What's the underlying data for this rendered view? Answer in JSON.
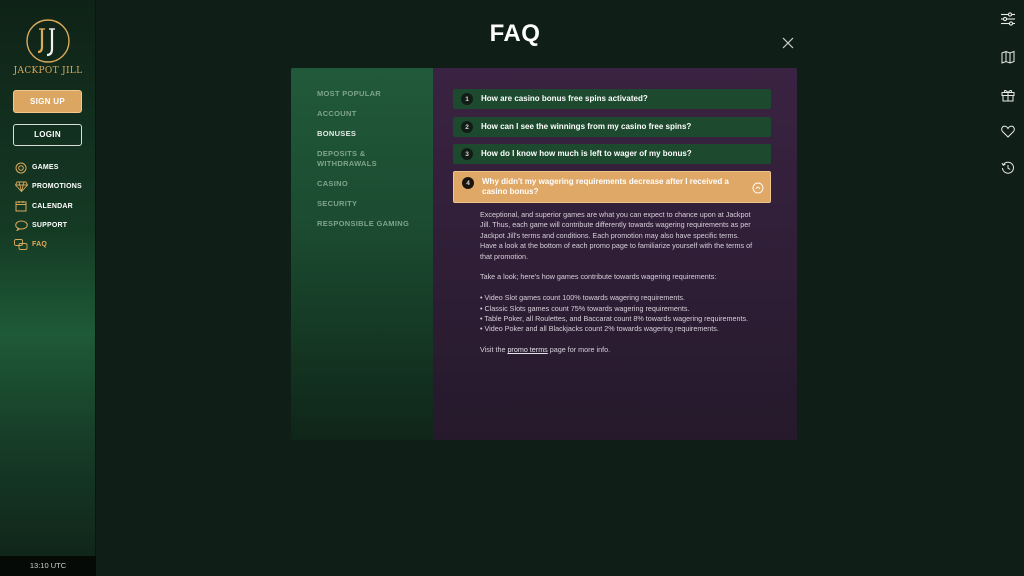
{
  "brand": {
    "name": "JACKPOT JILL",
    "logo_monogram": "JJ"
  },
  "sidebar": {
    "signup_label": "SIGN UP",
    "login_label": "LOGIN",
    "items": [
      {
        "label": "GAMES",
        "icon": "games-icon"
      },
      {
        "label": "PROMOTIONS",
        "icon": "diamond-icon"
      },
      {
        "label": "CALENDAR",
        "icon": "calendar-icon"
      },
      {
        "label": "SUPPORT",
        "icon": "support-icon"
      },
      {
        "label": "FAQ",
        "icon": "faq-icon",
        "active": true
      }
    ],
    "clock": "13:10 UTC"
  },
  "rail": {
    "icons": [
      "sliders-icon",
      "map-icon",
      "gift-icon",
      "heart-icon",
      "history-icon"
    ]
  },
  "faq": {
    "title": "FAQ",
    "categories": [
      {
        "label": "MOST POPULAR"
      },
      {
        "label": "ACCOUNT"
      },
      {
        "label": "BONUSES",
        "active": true
      },
      {
        "label": "DEPOSITS & WITHDRAWALS"
      },
      {
        "label": "CASINO"
      },
      {
        "label": "SECURITY"
      },
      {
        "label": "RESPONSIBLE GAMING"
      }
    ],
    "questions": [
      {
        "num": "1",
        "text": "How are casino bonus free spins activated?"
      },
      {
        "num": "2",
        "text": "How can I see the winnings from my casino free spins?"
      },
      {
        "num": "3",
        "text": "How do I know how much is left to wager of my bonus?"
      },
      {
        "num": "4",
        "text": "Why didn't my wagering requirements decrease after I received a casino bonus?",
        "open": true
      }
    ],
    "answer": {
      "p1": "Exceptional, and superior games are what you can expect to chance upon at Jackpot Jill. Thus, each game will contribute differently towards wagering requirements as per Jackpot Jill's terms and conditions. Each promotion may also have specific terms. Have a look at the bottom of each promo page to familiarize yourself with the terms of that promotion.",
      "p2": "Take a look; here's how games contribute towards wagering requirements:",
      "list": [
        "• Video Slot games count 100% towards wagering requirements.",
        "• Classic Slots games count 75% towards wagering requirements.",
        "• Table Poker, all Roulettes, and Baccarat count 8% towards wagering requirements.",
        "• Video Poker and all Blackjacks count 2% towards wagering requirements."
      ],
      "p3_before": "Visit the ",
      "p3_link": "promo terms",
      "p3_after": " page for more info."
    }
  },
  "colors": {
    "accent": "#e0a866",
    "green": "#1d4a2e",
    "purple": "#3a2342"
  }
}
